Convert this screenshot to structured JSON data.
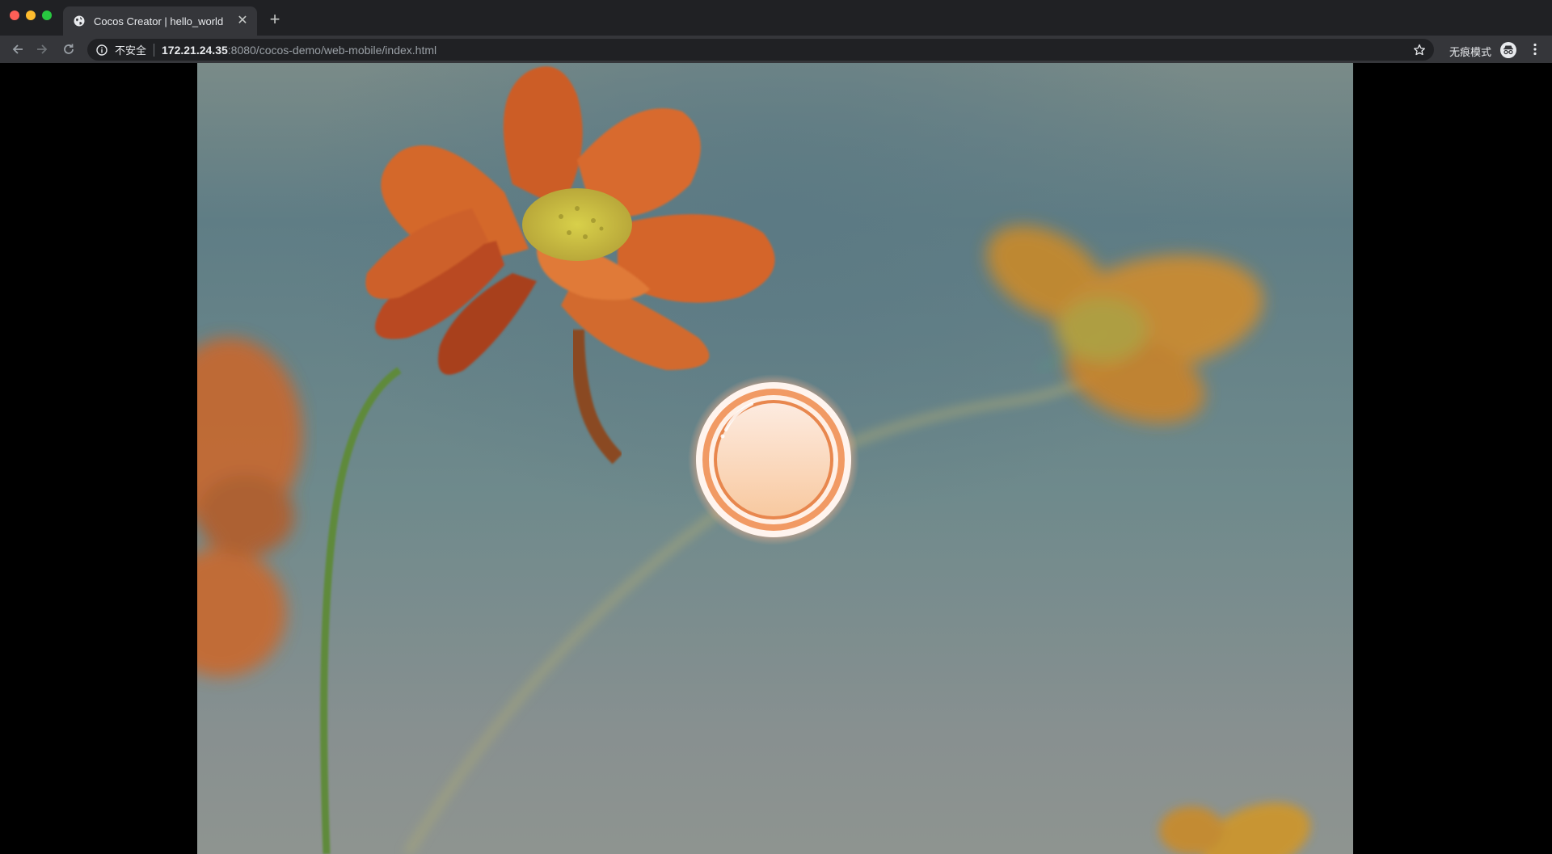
{
  "browser": {
    "tab": {
      "title": "Cocos Creator | hello_world",
      "favicon": "globe-icon",
      "close_icon": "close-icon"
    },
    "new_tab_icon": "plus-icon",
    "nav": {
      "back_icon": "arrow-left-icon",
      "forward_icon": "arrow-right-icon",
      "reload_icon": "reload-icon"
    },
    "omnibox": {
      "security_icon": "info-icon",
      "security_label": "不安全",
      "url_host": "172.21.24.35",
      "url_rest": ":8080/cocos-demo/web-mobile/index.html",
      "bookmark_icon": "star-icon"
    },
    "incognito": {
      "label": "无痕模式",
      "icon": "incognito-icon"
    },
    "menu_icon": "more-vert-icon"
  },
  "page": {
    "background": "flower-photo",
    "button": {
      "icon": "circle-button-icon"
    }
  },
  "colors": {
    "chrome_dark": "#202124",
    "chrome_toolbar": "#35363a",
    "petal_orange": "#d9662a",
    "button_ring": "#f19a64"
  }
}
